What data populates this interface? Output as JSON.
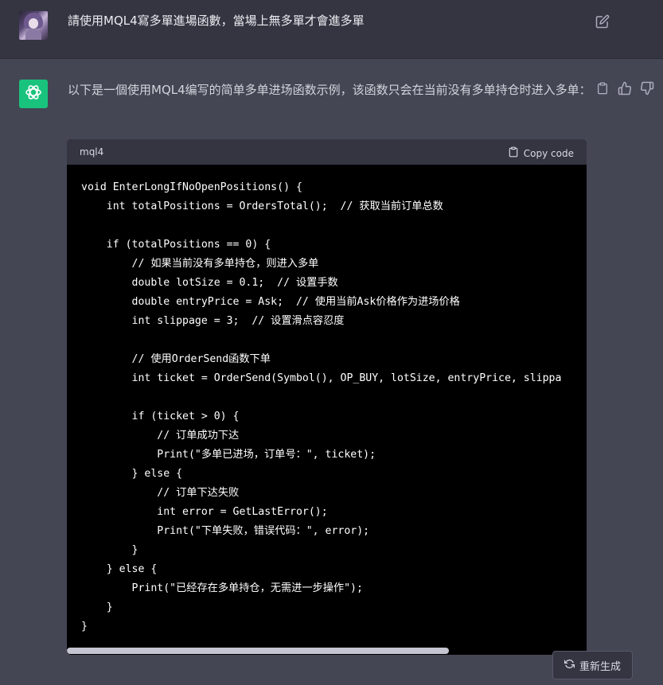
{
  "user_message": {
    "text": "請使用MQL4寫多單進場函數，當場上無多單才會進多單"
  },
  "assistant_message": {
    "text": "以下是一個使用MQL4编写的简单多单进场函数示例，该函数只会在当前没有多单持仓时进入多单："
  },
  "code_block": {
    "language": "mql4",
    "copy_label": "Copy code",
    "code": "void EnterLongIfNoOpenPositions() {\n    int totalPositions = OrdersTotal();  // 获取当前订单总数\n\n    if (totalPositions == 0) {\n        // 如果当前没有多单持仓，则进入多单\n        double lotSize = 0.1;  // 设置手数\n        double entryPrice = Ask;  // 使用当前Ask价格作为进场价格\n        int slippage = 3;  // 设置滑点容忍度\n\n        // 使用OrderSend函数下单\n        int ticket = OrderSend(Symbol(), OP_BUY, lotSize, entryPrice, slippa\n\n        if (ticket > 0) {\n            // 订单成功下达\n            Print(\"多单已进场，订单号：\", ticket);\n        } else {\n            // 订单下达失败\n            int error = GetLastError();\n            Print(\"下单失败，错误代码：\", error);\n        }\n    } else {\n        Print(\"已经存在多单持仓，无需进一步操作\");\n    }\n}"
  },
  "regenerate_label": "重新生成",
  "icons": {
    "edit": "edit-icon",
    "copy": "clipboard-icon",
    "thumbs_up": "thumbs-up-icon",
    "thumbs_down": "thumbs-down-icon",
    "regenerate": "refresh-icon",
    "assistant_logo": "openai-logo-icon"
  },
  "colors": {
    "accent": "#19c37d",
    "background": "#444654",
    "user_row": "#343541",
    "code_background": "#000000"
  }
}
